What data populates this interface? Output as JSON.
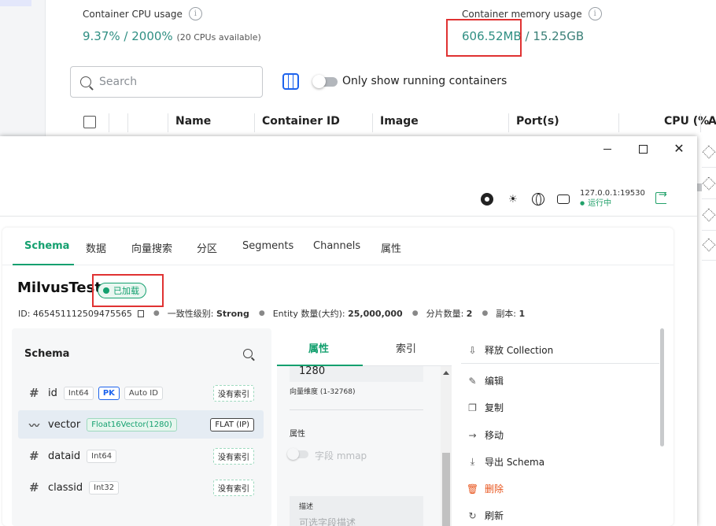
{
  "docker": {
    "cpu": {
      "label": "Container CPU usage",
      "value": "9.37% / 2000%",
      "sub": "(20 CPUs available)"
    },
    "memory": {
      "label": "Container memory usage",
      "used": "606.52MB",
      "total": "/ 15.25GB"
    },
    "search": {
      "placeholder": "Search"
    },
    "running_toggle": {
      "label": "Only show running containers",
      "on": false
    },
    "table": {
      "columns": [
        "Name",
        "Container ID",
        "Image",
        "Port(s)",
        "CPU (%",
        "A"
      ]
    }
  },
  "attu": {
    "window_controls": {
      "minimize": "—",
      "maximize": "☐",
      "close": "✕"
    },
    "topbar": {
      "address": "127.0.0.1:19530",
      "status": "运行中"
    },
    "tabs": [
      "Schema",
      "数据",
      "向量搜索",
      "分区",
      "Segments",
      "Channels",
      "属性"
    ],
    "active_tab": "Schema",
    "collection": {
      "name": "MilvusTest",
      "status": "已加载",
      "id_label": "ID:",
      "id": "465451112509475565",
      "consistency_label": "一致性级别:",
      "consistency": "Strong",
      "entity_label": "Entity 数量(大约):",
      "entity": "25,000,000",
      "shards_label": "分片数量:",
      "shards": "2",
      "replica_label": "副本:",
      "replica": "1"
    },
    "schema": {
      "title": "Schema",
      "fields": [
        {
          "name": "id",
          "type": "Int64",
          "pk": "PK",
          "auto": "Auto ID",
          "index": "没有索引",
          "icon": "#"
        },
        {
          "name": "vector",
          "type": "Float16Vector(1280)",
          "index": "FLAT (IP)",
          "icon": "vector"
        },
        {
          "name": "dataid",
          "type": "Int64",
          "index": "没有索引",
          "icon": "#"
        },
        {
          "name": "classid",
          "type": "Int32",
          "index": "没有索引",
          "icon": "#"
        }
      ]
    },
    "attr_panel": {
      "tabs": [
        "属性",
        "索引"
      ],
      "dim_value": "1280",
      "dim_label": "向量维度 (1-32768)",
      "attr_title": "属性",
      "mmap_label": "字段 mmap",
      "desc_label": "描述",
      "desc_placeholder": "可选字段描述"
    },
    "menu": {
      "items": [
        "释放 Collection",
        "编辑",
        "复制",
        "移动",
        "导出 Schema",
        "删除",
        "刷新"
      ],
      "icons": [
        "release-icon",
        "edit-icon",
        "copy-icon",
        "move-icon",
        "export-icon",
        "delete-icon",
        "refresh-icon"
      ]
    }
  },
  "colors": {
    "accent_green": "#14a06f",
    "docker_blue": "#1d63ed",
    "highlight_red": "#e03232",
    "danger": "#e8541c"
  }
}
